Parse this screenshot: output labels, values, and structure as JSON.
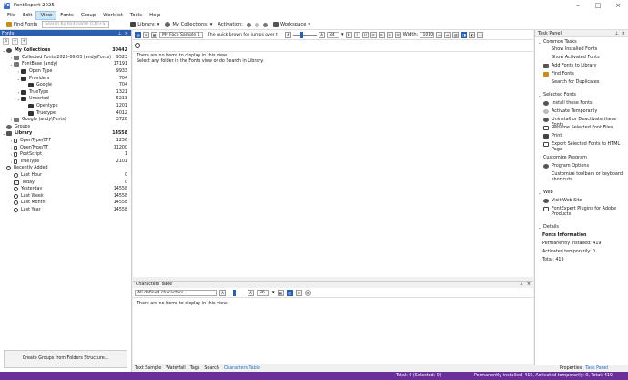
{
  "window": {
    "title": "FontExpert 2025",
    "app_icon": "Fe"
  },
  "menu": [
    "File",
    "Edit",
    "View",
    "Fonts",
    "Group",
    "Worklist",
    "Tools",
    "Help"
  ],
  "menu_active": "View",
  "toolbar": {
    "find_fonts": "Find Fonts",
    "search_placeholder": "Search by font name (Ctrl+S)",
    "library": "Library:",
    "my_collections": "My Collections:",
    "activation": "Activation:",
    "workspace": "Workspace"
  },
  "fonts_panel": {
    "title": "Fonts",
    "tree": [
      {
        "label": "My Collections",
        "count": "30442",
        "bold": true
      },
      {
        "label": "Collected Fonts 2025-06-03 (andy\\Fonts)",
        "count": "9523"
      },
      {
        "label": "FontBase (andy)",
        "count": "17191"
      },
      {
        "label": "Open Type",
        "count": "9933"
      },
      {
        "label": "Providers",
        "count": "704"
      },
      {
        "label": "Google",
        "count": "704"
      },
      {
        "label": "TrueType",
        "count": "1321"
      },
      {
        "label": "Unsorted",
        "count": "5213"
      },
      {
        "label": "Opentype",
        "count": "1201"
      },
      {
        "label": "Truetype",
        "count": "4012"
      },
      {
        "label": "Google (andy\\Fonts)",
        "count": "3728"
      },
      {
        "label": "Groups",
        "count": ""
      },
      {
        "label": "Library",
        "count": "14558",
        "bold": true
      },
      {
        "label": "OpenType/CFF",
        "count": "1256"
      },
      {
        "label": "OpenType/TT",
        "count": "11200"
      },
      {
        "label": "PostScript",
        "count": "1"
      },
      {
        "label": "TrueType",
        "count": "2101"
      },
      {
        "label": "Recently Added",
        "count": ""
      },
      {
        "label": "Last Hour",
        "count": "0"
      },
      {
        "label": "Today",
        "count": "0"
      },
      {
        "label": "Yesterday",
        "count": "14558"
      },
      {
        "label": "Last Week",
        "count": "14558"
      },
      {
        "label": "Last Month",
        "count": "14558"
      },
      {
        "label": "Last Year",
        "count": "14558"
      }
    ],
    "create_groups": "Create Groups from Folders Structure..."
  },
  "preview": {
    "sample_name": "My Face Sample 1",
    "sample_text": "The quick brown fox jumps over t",
    "size": "34",
    "width_label": "Width:",
    "width_value": "1010",
    "empty_line1": "There are no items to display in this view.",
    "empty_line2": "Select any folder in the Fonts view or do Search in Library."
  },
  "characters": {
    "title": "Characters Table",
    "filter": "All defined characters",
    "size": "36",
    "empty": "There are no items to display in this view."
  },
  "center_tabs": [
    "Text Sample",
    "Waterfall",
    "Tags",
    "Search",
    "Characters Table"
  ],
  "center_tab_active": "Characters Table",
  "task_panel": {
    "title": "Task Panel",
    "common_tasks": "Common Tasks",
    "common_items": [
      "Show Installed Fonts",
      "Show Activated Fonts",
      "Add Fonts to Library",
      "Find Fonts",
      "Search for Duplicates"
    ],
    "selected_fonts": "Selected Fonts",
    "selected_items": [
      "Install these Fonts",
      "Activate Temporarily",
      "Uninstall or Deactivate these Fonts",
      "Rename Selected Font Files",
      "Print",
      "Export Selected Fonts to HTML Page"
    ],
    "customize": "Customize Program",
    "customize_items": [
      "Program Options",
      "Customize toolbars or keyboard shortcuts"
    ],
    "web": "Web",
    "web_items": [
      "Visit Web Site",
      "FontExpert Plugins for Adobe Products"
    ],
    "details": "Details",
    "fonts_info": "Fonts Information",
    "perm": "Permanently installed: 419",
    "temp": "Activated temporarily: 0",
    "total": "Total: 419"
  },
  "right_tabs": [
    "Properties",
    "Task Panel"
  ],
  "right_tab_active": "Task Panel",
  "status": {
    "left": "Total: 0 (Selected: 0)",
    "right": "Permanently installed: 419, Activated temporarily: 0, Total: 419"
  },
  "colors": {
    "accent": "#2a5fb0",
    "status_bar": "#6b2f9a",
    "link": "#2a6fc9"
  }
}
